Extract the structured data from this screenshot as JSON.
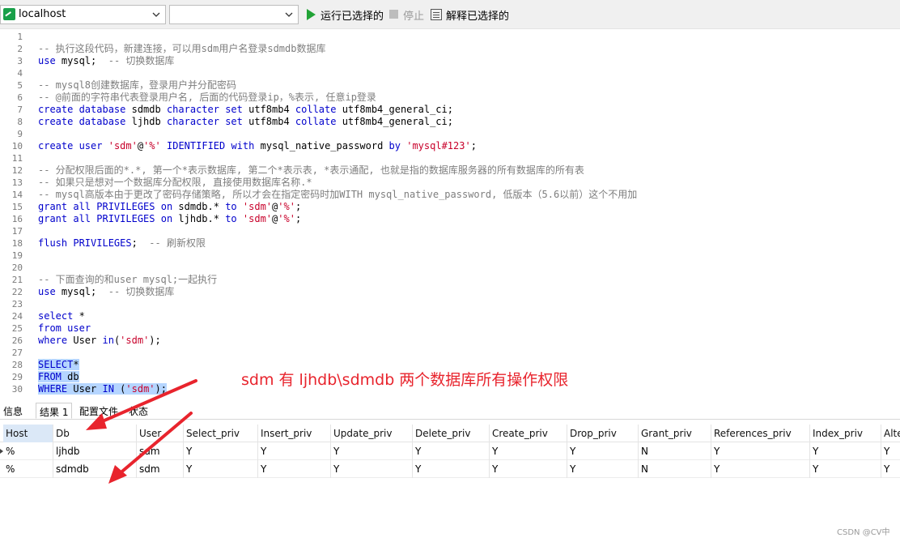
{
  "toolbar": {
    "connection": "localhost",
    "database": "",
    "run_selected": "运行已选择的",
    "stop": "停止",
    "explain_selected": "解释已选择的"
  },
  "editor": {
    "lines": [
      {
        "n": "1",
        "parts": []
      },
      {
        "n": "2",
        "parts": [
          {
            "t": "-- 执行这段代码，新建连接，可以用sdm用户名登录sdmdb数据库",
            "c": "cm"
          }
        ]
      },
      {
        "n": "3",
        "parts": [
          {
            "t": "use",
            "c": "kw"
          },
          {
            "t": " mysql;  ",
            "c": ""
          },
          {
            "t": "-- 切换数据库",
            "c": "cm"
          }
        ]
      },
      {
        "n": "4",
        "parts": []
      },
      {
        "n": "5",
        "parts": [
          {
            "t": "-- mysql8创建数据库，登录用户并分配密码",
            "c": "cm"
          }
        ]
      },
      {
        "n": "6",
        "parts": [
          {
            "t": "-- @前面的字符串代表登录用户名, 后面的代码登录ip，%表示, 任意ip登录",
            "c": "cm"
          }
        ]
      },
      {
        "n": "7",
        "parts": [
          {
            "t": "create database",
            "c": "kw"
          },
          {
            "t": " sdmdb ",
            "c": ""
          },
          {
            "t": "character set",
            "c": "kw"
          },
          {
            "t": " utf8mb4 ",
            "c": ""
          },
          {
            "t": "collate",
            "c": "kw"
          },
          {
            "t": " utf8mb4_general_ci;",
            "c": ""
          }
        ]
      },
      {
        "n": "8",
        "parts": [
          {
            "t": "create database",
            "c": "kw"
          },
          {
            "t": " ljhdb ",
            "c": ""
          },
          {
            "t": "character set",
            "c": "kw"
          },
          {
            "t": " utf8mb4 ",
            "c": ""
          },
          {
            "t": "collate",
            "c": "kw"
          },
          {
            "t": " utf8mb4_general_ci;",
            "c": ""
          }
        ]
      },
      {
        "n": "9",
        "parts": []
      },
      {
        "n": "10",
        "parts": [
          {
            "t": "create user",
            "c": "kw"
          },
          {
            "t": " ",
            "c": ""
          },
          {
            "t": "'sdm'",
            "c": "str"
          },
          {
            "t": "@",
            "c": ""
          },
          {
            "t": "'%'",
            "c": "str"
          },
          {
            "t": " ",
            "c": ""
          },
          {
            "t": "IDENTIFIED with",
            "c": "kw"
          },
          {
            "t": " mysql_native_password ",
            "c": ""
          },
          {
            "t": "by",
            "c": "kw"
          },
          {
            "t": " ",
            "c": ""
          },
          {
            "t": "'mysql#123'",
            "c": "str"
          },
          {
            "t": ";",
            "c": ""
          }
        ]
      },
      {
        "n": "11",
        "parts": []
      },
      {
        "n": "12",
        "parts": [
          {
            "t": "-- 分配权限后面的*.*, 第一个*表示数据库, 第二个*表示表, *表示通配, 也就是指的数据库服务器的所有数据库的所有表",
            "c": "cm"
          }
        ]
      },
      {
        "n": "13",
        "parts": [
          {
            "t": "-- 如果只是想对一个数据库分配权限, 直接使用数据库名称.*",
            "c": "cm"
          }
        ]
      },
      {
        "n": "14",
        "parts": [
          {
            "t": "-- mysql高版本由于更改了密码存储策略, 所以才会在指定密码时加WITH mysql_native_password, 低版本（5.6以前）这个不用加",
            "c": "cm"
          }
        ]
      },
      {
        "n": "15",
        "parts": [
          {
            "t": "grant all PRIVILEGES on",
            "c": "kw"
          },
          {
            "t": " sdmdb.* ",
            "c": ""
          },
          {
            "t": "to",
            "c": "kw"
          },
          {
            "t": " ",
            "c": ""
          },
          {
            "t": "'sdm'",
            "c": "str"
          },
          {
            "t": "@",
            "c": ""
          },
          {
            "t": "'%'",
            "c": "str"
          },
          {
            "t": ";",
            "c": ""
          }
        ]
      },
      {
        "n": "16",
        "parts": [
          {
            "t": "grant all PRIVILEGES on",
            "c": "kw"
          },
          {
            "t": " ljhdb.* ",
            "c": ""
          },
          {
            "t": "to",
            "c": "kw"
          },
          {
            "t": " ",
            "c": ""
          },
          {
            "t": "'sdm'",
            "c": "str"
          },
          {
            "t": "@",
            "c": ""
          },
          {
            "t": "'%'",
            "c": "str"
          },
          {
            "t": ";",
            "c": ""
          }
        ]
      },
      {
        "n": "17",
        "parts": []
      },
      {
        "n": "18",
        "parts": [
          {
            "t": "flush PRIVILEGES",
            "c": "kw"
          },
          {
            "t": ";  ",
            "c": ""
          },
          {
            "t": "-- 刷新权限",
            "c": "cm"
          }
        ]
      },
      {
        "n": "19",
        "parts": []
      },
      {
        "n": "20",
        "parts": []
      },
      {
        "n": "21",
        "parts": [
          {
            "t": "-- 下面查询的和user mysql;一起执行",
            "c": "cm"
          }
        ]
      },
      {
        "n": "22",
        "parts": [
          {
            "t": "use",
            "c": "kw"
          },
          {
            "t": " mysql;  ",
            "c": ""
          },
          {
            "t": "-- 切换数据库",
            "c": "cm"
          }
        ]
      },
      {
        "n": "23",
        "parts": []
      },
      {
        "n": "24",
        "parts": [
          {
            "t": "select",
            "c": "kw"
          },
          {
            "t": " *",
            "c": ""
          }
        ]
      },
      {
        "n": "25",
        "parts": [
          {
            "t": "from",
            "c": "kw"
          },
          {
            "t": " ",
            "c": ""
          },
          {
            "t": "user",
            "c": "kw"
          }
        ]
      },
      {
        "n": "26",
        "parts": [
          {
            "t": "where",
            "c": "kw"
          },
          {
            "t": " User ",
            "c": ""
          },
          {
            "t": "in",
            "c": "kw"
          },
          {
            "t": "(",
            "c": ""
          },
          {
            "t": "'sdm'",
            "c": "str"
          },
          {
            "t": ");",
            "c": ""
          }
        ]
      },
      {
        "n": "27",
        "parts": []
      },
      {
        "n": "28",
        "parts": [
          {
            "t": "SELECT",
            "c": "kw sel"
          },
          {
            "t": "*",
            "c": "sel"
          }
        ]
      },
      {
        "n": "29",
        "parts": [
          {
            "t": "FROM",
            "c": "kw sel"
          },
          {
            "t": " db",
            "c": "sel"
          }
        ]
      },
      {
        "n": "30",
        "parts": [
          {
            "t": "WHERE",
            "c": "kw sel"
          },
          {
            "t": " User ",
            "c": "sel"
          },
          {
            "t": "IN",
            "c": "kw sel"
          },
          {
            "t": " (",
            "c": "sel"
          },
          {
            "t": "'sdm'",
            "c": "str sel"
          },
          {
            "t": ");",
            "c": "sel"
          }
        ]
      }
    ]
  },
  "annotation": "sdm 有 ljhdb\\sdmdb 两个数据库所有操作权限",
  "panel": {
    "tabs": [
      "信息",
      "结果 1",
      "配置文件",
      "状态"
    ],
    "active_tab": 1
  },
  "result": {
    "columns": [
      "Host",
      "Db",
      "User",
      "Select_priv",
      "Insert_priv",
      "Update_priv",
      "Delete_priv",
      "Create_priv",
      "Drop_priv",
      "Grant_priv",
      "References_priv",
      "Index_priv",
      "Alte"
    ],
    "rows": [
      [
        "%",
        "ljhdb",
        "sdm",
        "Y",
        "Y",
        "Y",
        "Y",
        "Y",
        "Y",
        "N",
        "Y",
        "Y",
        "Y"
      ],
      [
        "%",
        "sdmdb",
        "sdm",
        "Y",
        "Y",
        "Y",
        "Y",
        "Y",
        "Y",
        "N",
        "Y",
        "Y",
        "Y"
      ]
    ]
  },
  "watermark": "CSDN @CV中",
  "colors": {
    "annotation": "#e8242d",
    "keyword": "#0000cc",
    "string": "#c8002a",
    "comment": "#7e7e7e",
    "selection": "#b5d5ff"
  },
  "icons": [
    "connection-icon",
    "chevron-down-icon",
    "play-icon",
    "stop-icon",
    "explain-icon"
  ]
}
